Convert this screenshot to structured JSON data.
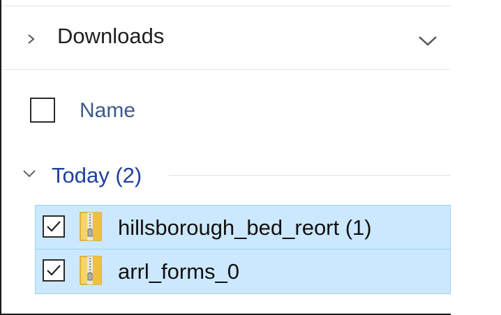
{
  "header": {
    "folder_label": "Downloads"
  },
  "columns": {
    "name_label": "Name"
  },
  "group": {
    "label": "Today (2)"
  },
  "files": [
    {
      "name": "hillsborough_bed_reort (1)",
      "checked": true,
      "icon": "zip-folder-icon"
    },
    {
      "name": "arrl_forms_0",
      "checked": true,
      "icon": "zip-folder-icon"
    }
  ],
  "colors": {
    "selection_bg": "#cce8ff",
    "selection_border": "#99d1ff",
    "group_text": "#1f3f9a",
    "column_header_text": "#3c5a8a"
  }
}
